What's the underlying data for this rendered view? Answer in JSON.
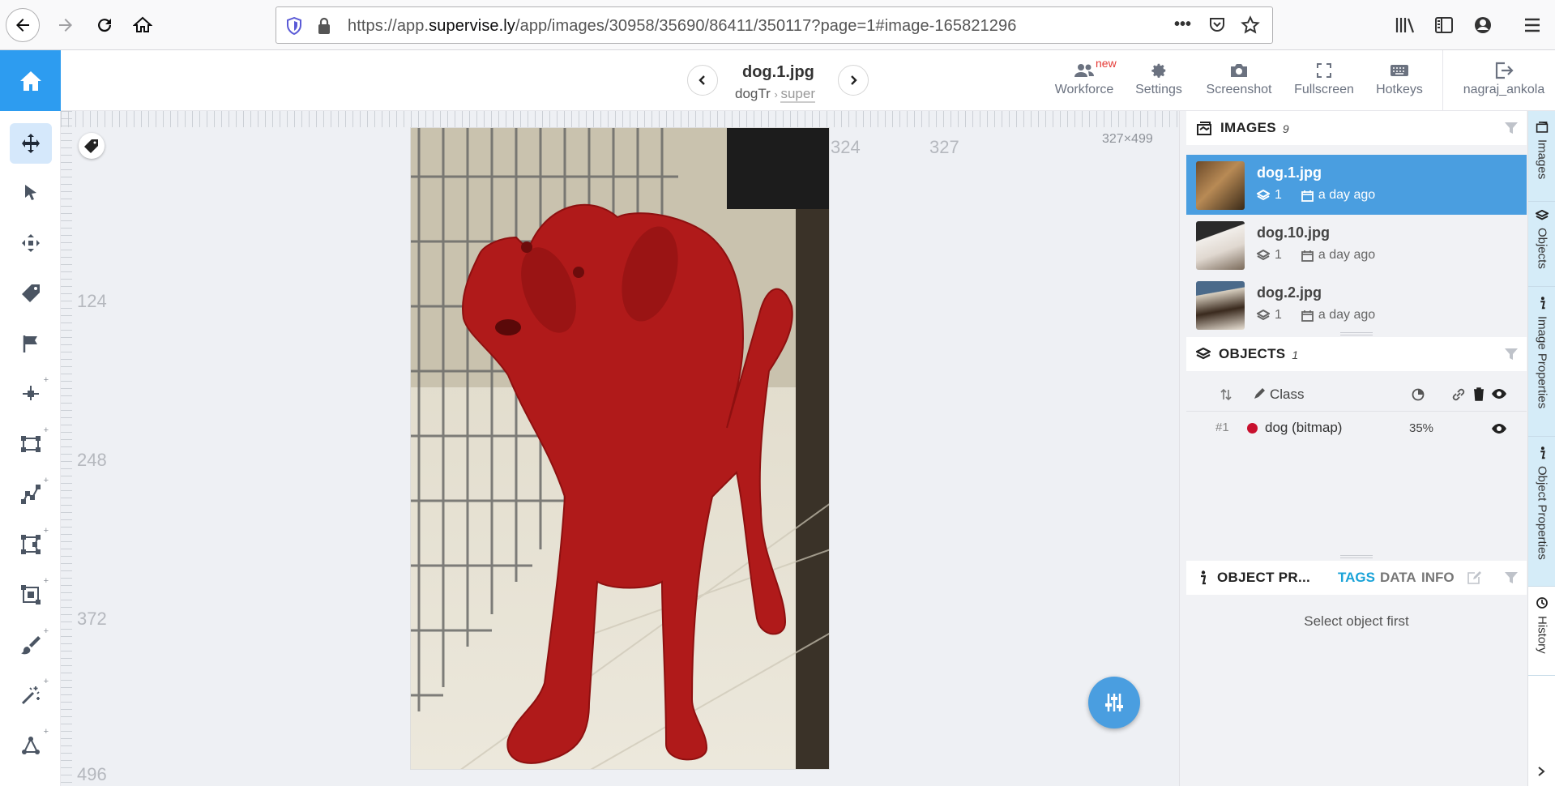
{
  "browser": {
    "url_prefix": "https://app.",
    "url_domain": "supervise.ly",
    "url_rest": "/app/images/30958/35690/86411/350117?page=1#image-165821296"
  },
  "header": {
    "image_title": "dog.1.jpg",
    "crumb_project": "dogTr",
    "crumb_dataset": "super",
    "new_badge": "new",
    "tools": [
      {
        "label": "Workforce",
        "icon": "users-icon"
      },
      {
        "label": "Settings",
        "icon": "gear-icon"
      },
      {
        "label": "Screenshot",
        "icon": "camera-icon"
      },
      {
        "label": "Fullscreen",
        "icon": "fullscreen-icon"
      },
      {
        "label": "Hotkeys",
        "icon": "keyboard-icon"
      },
      {
        "label": "nagraj_ankola",
        "icon": "logout-icon"
      }
    ]
  },
  "canvas": {
    "ruler_top_labels": [
      "324",
      "327"
    ],
    "ruler_left_labels": [
      "124",
      "248",
      "372",
      "496"
    ],
    "dimensions": "327×499"
  },
  "images_panel": {
    "title": "IMAGES",
    "count": "9",
    "items": [
      {
        "name": "dog.1.jpg",
        "layers": "1",
        "date": "a day ago",
        "selected": true
      },
      {
        "name": "dog.10.jpg",
        "layers": "1",
        "date": "a day ago",
        "selected": false
      },
      {
        "name": "dog.2.jpg",
        "layers": "1",
        "date": "a day ago",
        "selected": false
      }
    ]
  },
  "objects_panel": {
    "title": "OBJECTS",
    "count": "1",
    "col_class": "Class",
    "rows": [
      {
        "index": "#1",
        "name": "dog (bitmap)",
        "area": "35%",
        "color": "#c8102e"
      }
    ]
  },
  "object_props_panel": {
    "title": "OBJECT PR...",
    "tabs": [
      "TAGS",
      "DATA",
      "INFO"
    ],
    "active_tab": "TAGS",
    "placeholder": "Select object first"
  },
  "side_tabs": [
    "Images",
    "Objects",
    "Image Properties",
    "Object Properties",
    "History"
  ],
  "colors": {
    "accent": "#2d9cf0",
    "selected_row": "#4a9ee0",
    "mask": "#b01a1a"
  }
}
